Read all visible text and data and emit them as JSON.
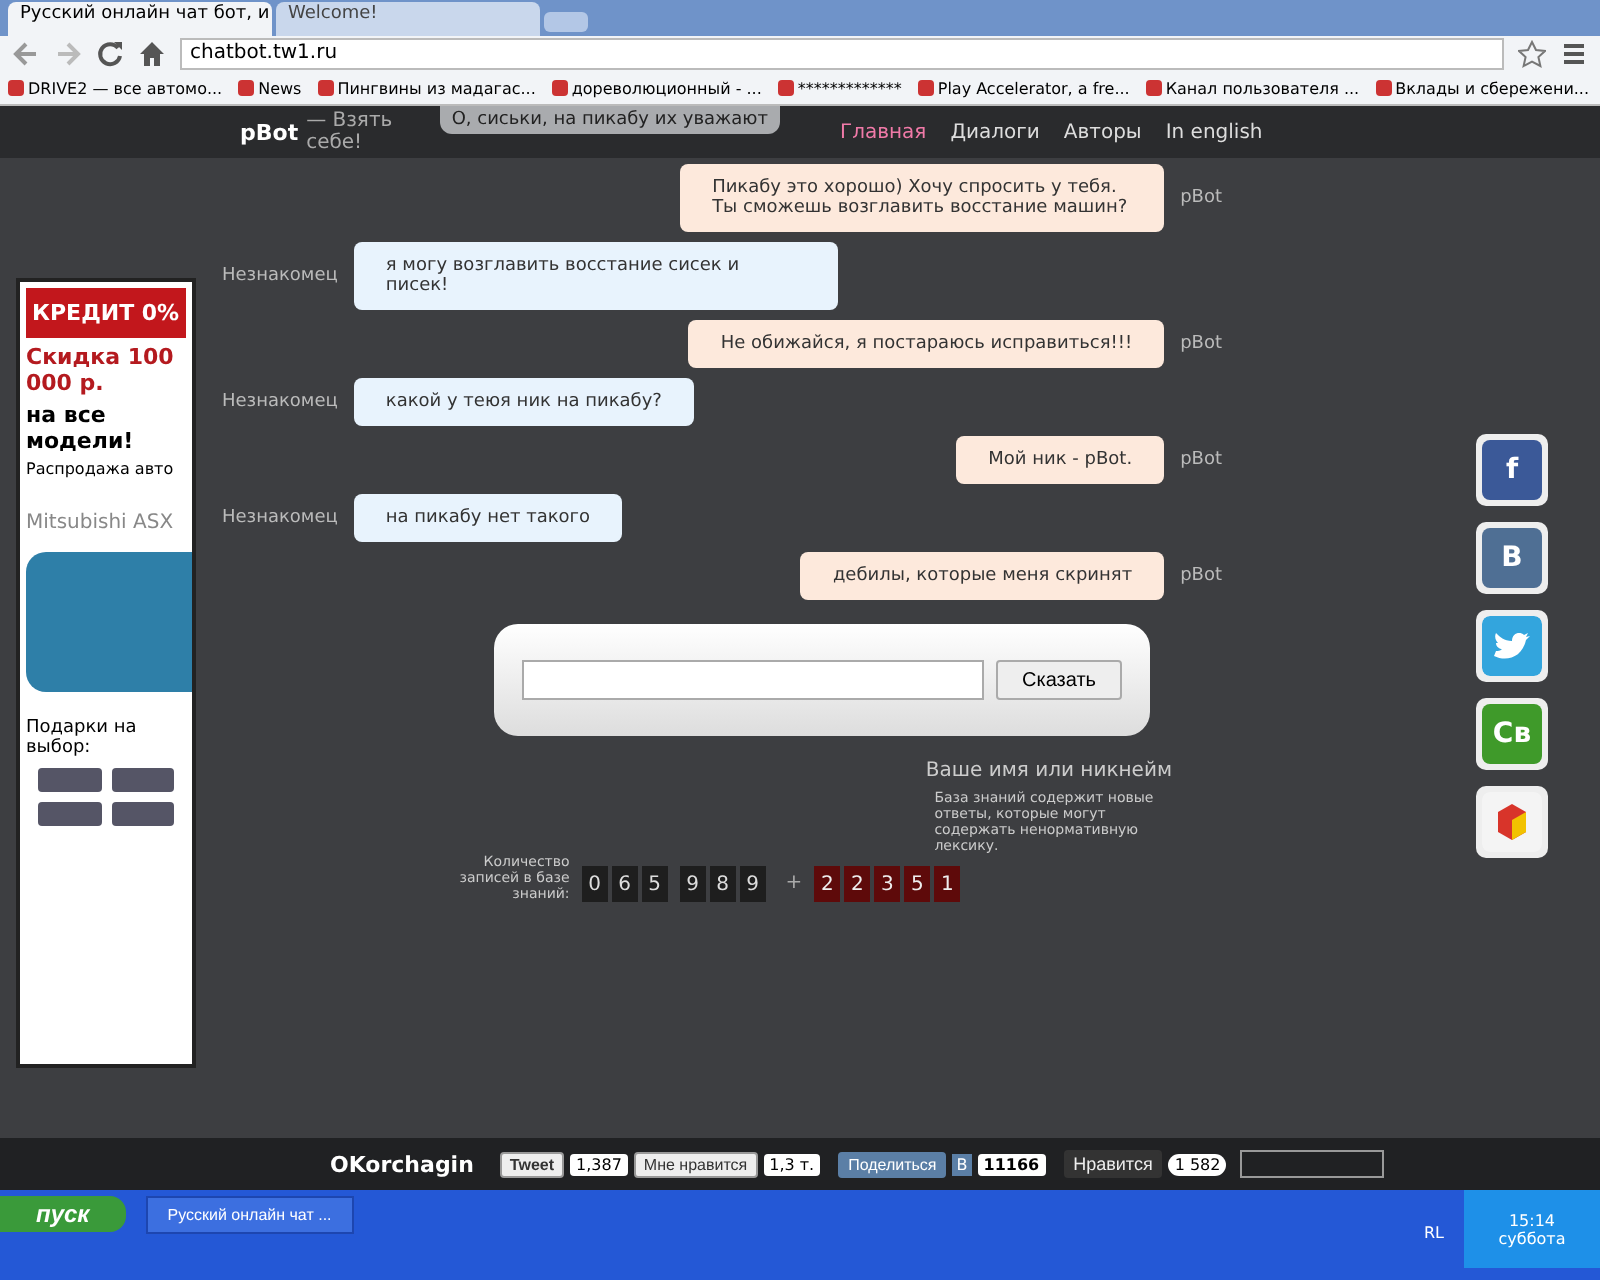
{
  "browser": {
    "tabs": [
      {
        "title": "Русский онлайн чат бот, и",
        "selected": true
      },
      {
        "title": "Welcome!",
        "selected": false
      }
    ],
    "url": "chatbot.tw1.ru",
    "bookmarks": [
      "DRIVE2 — все автомо...",
      "News",
      "Пингвины из мадагас...",
      "дореволюционный - ...",
      "*************",
      "Play Accelerator, a fre...",
      "Канал пользователя ...",
      "Вклады и сбережени..."
    ]
  },
  "header": {
    "logo": "pBot",
    "slogan": "— Взять себе!",
    "tooltip": "О, сиськи, на пикабу их уважают",
    "nav": [
      {
        "label": "Главная",
        "selected": true
      },
      {
        "label": "Диалоги",
        "selected": false
      },
      {
        "label": "Авторы",
        "selected": false
      },
      {
        "label": "In english",
        "selected": false
      }
    ]
  },
  "chat": [
    {
      "kind": "bot",
      "speaker": "pBot",
      "text": "Пикабу это хорошо) Хочу спросить у тебя. Ты сможешь возглавить восстание машин?"
    },
    {
      "kind": "user",
      "speaker": "Незнакомец",
      "text": "я могу возглавить восстание сисек и писек!"
    },
    {
      "kind": "bot",
      "speaker": "pBot",
      "text": "Не обижайся, я постараюсь исправиться!!!"
    },
    {
      "kind": "user",
      "speaker": "Незнакомец",
      "text": "какой у теюя ник на пикабу?"
    },
    {
      "kind": "bot",
      "speaker": "pBot",
      "text": "Мой ник - pBot."
    },
    {
      "kind": "user",
      "speaker": "Незнакомец",
      "text": "на пикабу нет такого"
    },
    {
      "kind": "bot",
      "speaker": "pBot",
      "text": "дебилы, которые меня скринят"
    }
  ],
  "input": {
    "button": "Сказать",
    "name_hint": "Ваше имя или никнейм"
  },
  "counter": {
    "label": "Количество записей в базе знаний:",
    "base_digits": [
      "0",
      "6",
      "5",
      "9",
      "8",
      "9"
    ],
    "plus": "+",
    "new_digits": [
      "2",
      "2",
      "3",
      "5",
      "1"
    ],
    "note": "База знаний содержит новые ответы, которые могут содержать ненормативную лексику."
  },
  "ad": {
    "headline": "КРЕДИТ 0%",
    "discount": "Скидка 100 000 р.",
    "offer": "на все модели!",
    "sale": "Распродажа авто",
    "model": "Mitsubishi ASX",
    "gifts": "Подарки на выбор:"
  },
  "social": [
    {
      "kind": "letter",
      "glyph": "f",
      "color": "#3b5998"
    },
    {
      "kind": "letter",
      "glyph": "В",
      "color": "#4f6f94"
    },
    {
      "kind": "bird",
      "color": "#33a5dd"
    },
    {
      "kind": "letter",
      "glyph": "Св",
      "color": "#3f9a2a"
    },
    {
      "kind": "cube",
      "color": "#d8342a"
    }
  ],
  "footer": {
    "author": "OKorchagin",
    "tweet": "Tweet",
    "tweet_count": "1,387",
    "like": "Мне нравится",
    "like_count": "1,3 т.",
    "share": "Поделиться",
    "share_letter": "В",
    "share_count": "11166",
    "plus_like": "Нравится",
    "plus_count": "1 582"
  },
  "taskbar": {
    "start": "пуск",
    "task": "Русский онлайн чат ...",
    "lang": "RL",
    "time": "15:14",
    "day": "суббота"
  }
}
